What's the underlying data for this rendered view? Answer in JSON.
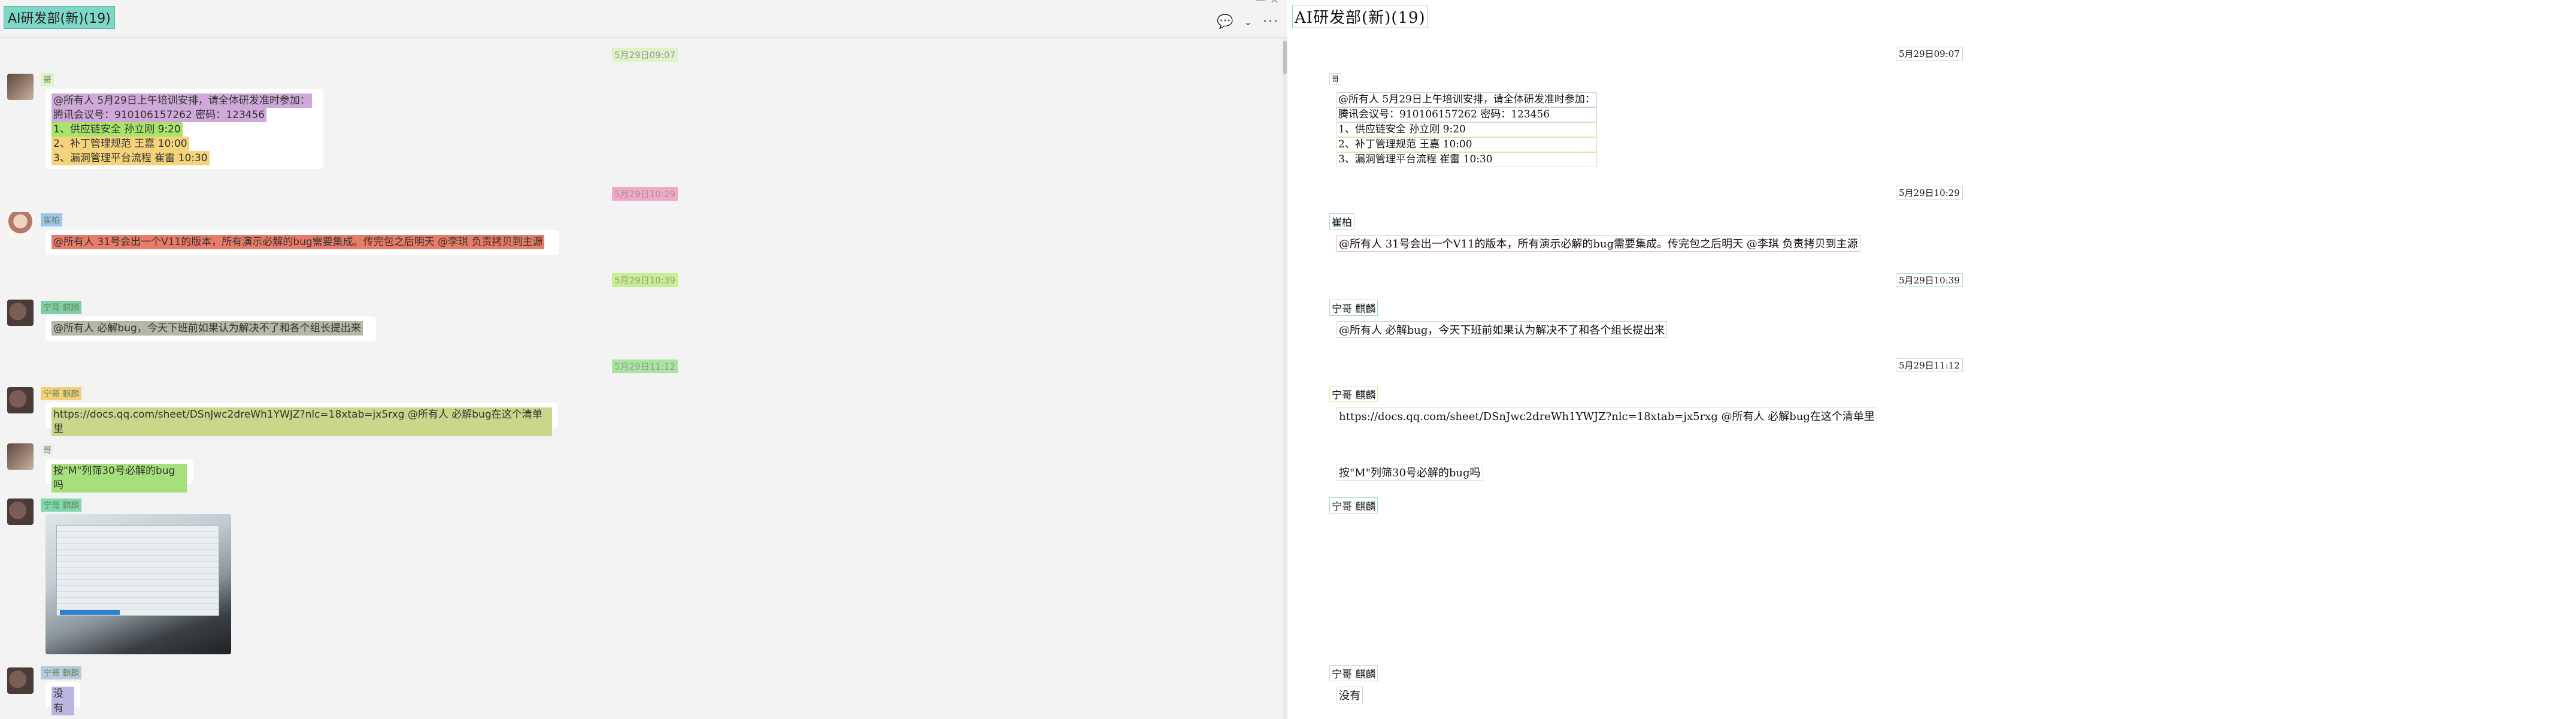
{
  "chat": {
    "title": "AI研发部(新)(19)"
  },
  "header": {
    "icons": [
      "chat-bubble-icon",
      "chevron-down-icon",
      "more-icon"
    ]
  },
  "messages": [
    {
      "timestamp": "5月29日09:07",
      "sender": "哥",
      "lines": [
        "@所有人 5月29日上午培训安排，请全体研发准时参加：",
        "腾讯会议号：910106157262  密码：123456",
        "1、供应链安全  孙立刚  9:20",
        "2、补丁管理规范  王嘉  10:00",
        "3、漏洞管理平台流程  崔雷 10:30"
      ]
    },
    {
      "timestamp": "5月29日10:29",
      "sender": "崔柏",
      "lines": [
        "@所有人 31号会出一个V11的版本，所有演示必解的bug需要集成。传完包之后明天 @李琪 负责拷贝到主源"
      ]
    },
    {
      "timestamp": "5月29日10:39",
      "sender": "宁哥 麒麟",
      "lines": [
        "@所有人 必解bug，今天下班前如果认为解决不了和各个组长提出来"
      ]
    },
    {
      "timestamp": "5月29日11:12",
      "sender": "宁哥 麒麟",
      "lines": [
        "https://docs.qq.com/sheet/DSnJwc2dreWh1YWJZ?nlc=18xtab=jx5rxg @所有人 必解bug在这个清单里"
      ]
    },
    {
      "timestamp": "",
      "sender": "哥",
      "lines": [
        "按\"M\"列筛30号必解的bug吗"
      ]
    },
    {
      "timestamp": "",
      "sender": "宁哥 麒麟",
      "lines": []
    },
    {
      "timestamp": "",
      "sender": "宁哥 麒麟",
      "lines": [
        "没有"
      ]
    }
  ],
  "colors": {
    "title_highlight": "#7fd8c7",
    "hl_purple": "#cfa9d9",
    "hl_green": "#a9e36b",
    "hl_yellow": "#f5d37a",
    "hl_red": "#e87c69",
    "hl_grey": "#b7b7a5",
    "hl_olive": "#c8d78a",
    "hl_lav": "#b9b7e0"
  }
}
